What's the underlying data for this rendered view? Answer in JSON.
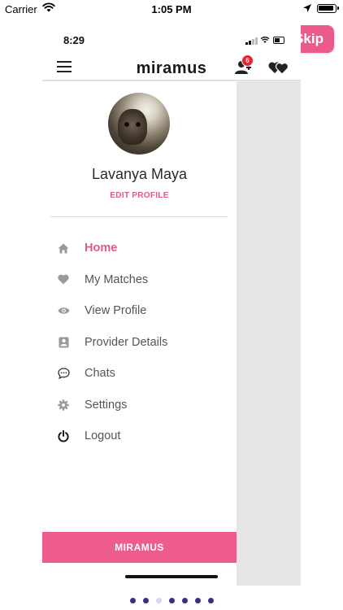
{
  "status_bar": {
    "carrier": "Carrier",
    "time": "1:05 PM"
  },
  "skip_label": "Skip",
  "device": {
    "time": "8:29"
  },
  "app_bar": {
    "logo": "miramus",
    "notification_count": "6"
  },
  "profile": {
    "name": "Lavanya Maya",
    "edit_label": "EDIT PROFILE"
  },
  "menu": {
    "items": [
      {
        "label": "Home",
        "icon": "home-icon",
        "active": true
      },
      {
        "label": "My Matches",
        "icon": "heart-icon",
        "active": false
      },
      {
        "label": "View Profile",
        "icon": "eye-icon",
        "active": false
      },
      {
        "label": "Provider Details",
        "icon": "contact-card-icon",
        "active": false
      },
      {
        "label": "Chats",
        "icon": "chat-bubble-icon",
        "active": false
      },
      {
        "label": "Settings",
        "icon": "gear-icon",
        "active": false
      },
      {
        "label": "Logout",
        "icon": "power-icon",
        "active": false
      }
    ]
  },
  "footer_label": "MIRAMUS",
  "pagination": {
    "total": 7,
    "current": 3
  },
  "colors": {
    "accent": "#ec5a89",
    "badge": "#e3262f",
    "dot_active": "#3b2f8a"
  }
}
